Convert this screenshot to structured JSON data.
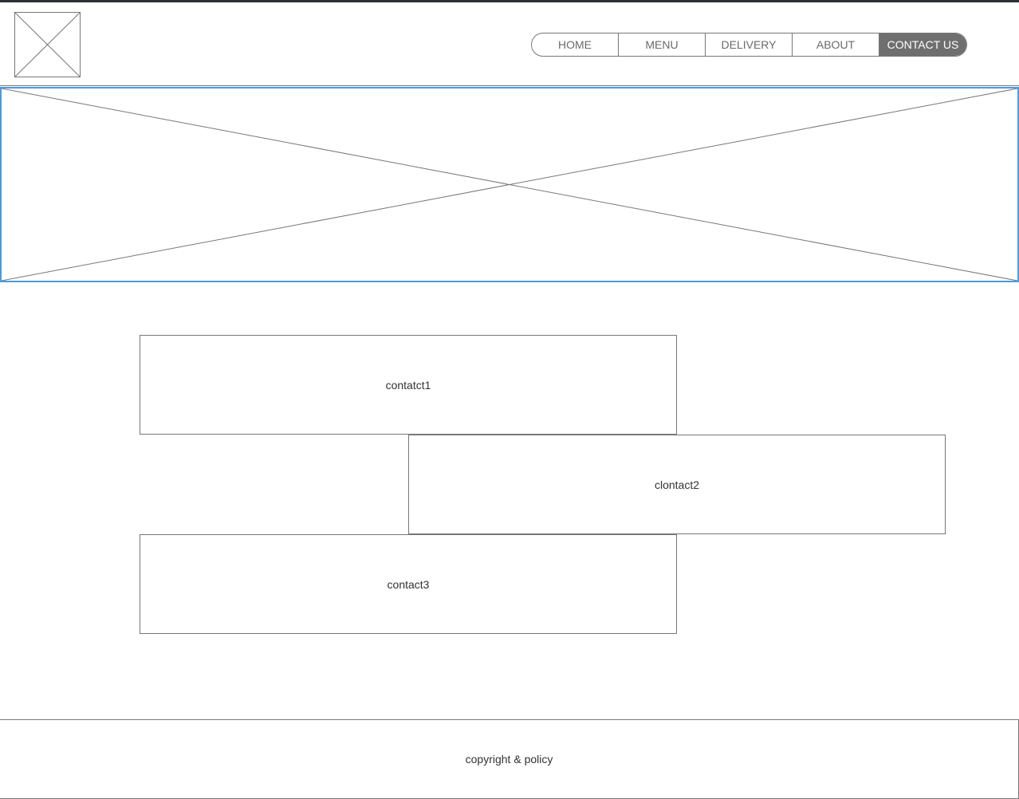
{
  "header": {
    "logo_icon": "image-placeholder-icon",
    "nav": [
      {
        "label": "HOME",
        "active": false
      },
      {
        "label": "MENU",
        "active": false
      },
      {
        "label": "DELIVERY",
        "active": false
      },
      {
        "label": "ABOUT",
        "active": false
      },
      {
        "label": "CONTACT US",
        "active": true
      }
    ]
  },
  "hero": {
    "icon": "image-placeholder-icon",
    "accent_color": "#4a9be0"
  },
  "contacts": [
    {
      "label": "contatct1"
    },
    {
      "label": "clontact2"
    },
    {
      "label": "contact3"
    }
  ],
  "footer": {
    "text": "copyright & policy"
  },
  "colors": {
    "nav_active_bg": "#6f6f6f",
    "border": "#777777",
    "top_strip": "#2b2f36"
  }
}
